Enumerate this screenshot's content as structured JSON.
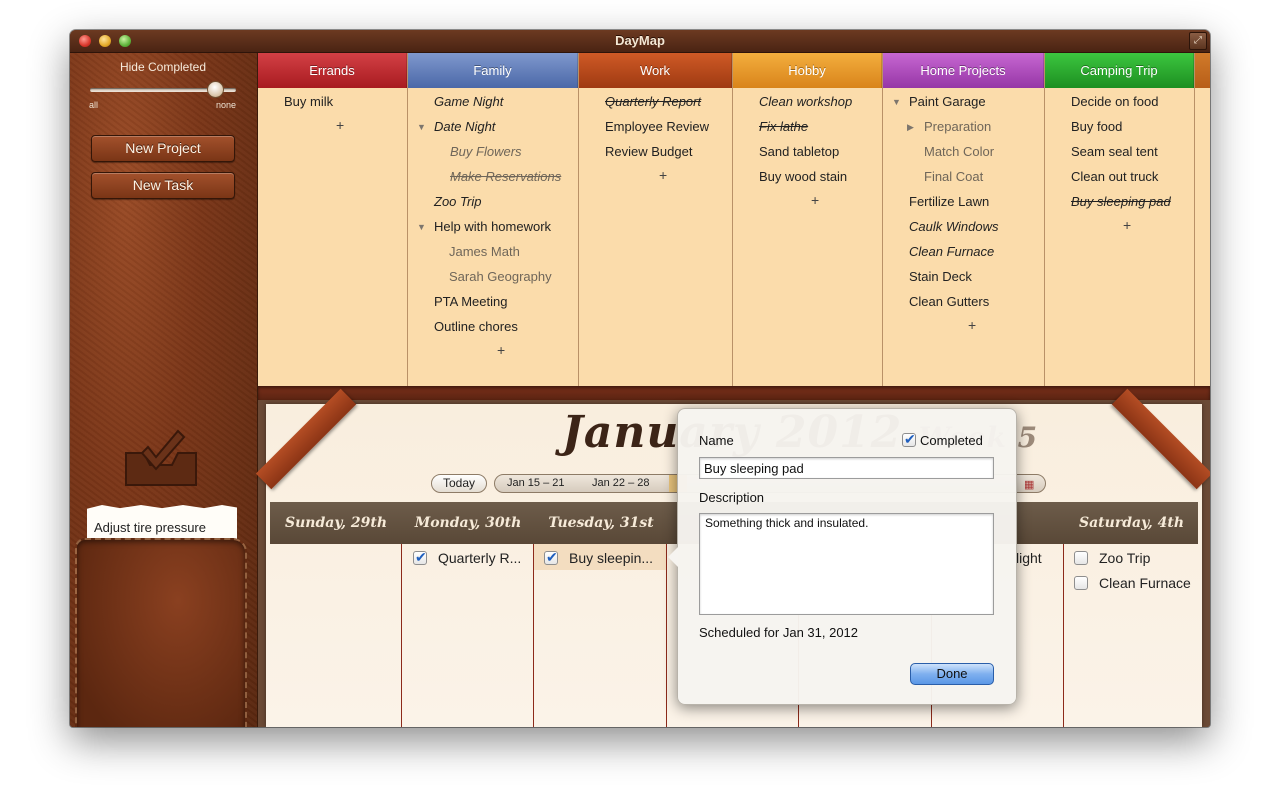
{
  "window": {
    "title": "DayMap"
  },
  "sidebar": {
    "hide_completed": "Hide Completed",
    "slider_min": "all",
    "slider_max": "none",
    "slider_value": 0.85,
    "new_project": "New Project",
    "new_task": "New Task",
    "note_text": "Adjust tire pressure"
  },
  "projects": [
    {
      "name": "Errands",
      "color": "#b8242a",
      "items": [
        {
          "text": "Buy milk"
        }
      ]
    },
    {
      "name": "Family",
      "color": "#5d78b2",
      "items": [
        {
          "text": "Game Night"
        },
        {
          "text": "Date Night"
        },
        {
          "text": "Buy Flowers"
        },
        {
          "text": "Make Reservations"
        },
        {
          "text": "Zoo Trip"
        },
        {
          "text": "Help with homework"
        },
        {
          "text": "James Math"
        },
        {
          "text": "Sarah Geography"
        },
        {
          "text": "PTA Meeting"
        },
        {
          "text": "Outline chores"
        }
      ]
    },
    {
      "name": "Work",
      "color": "#b8471d",
      "items": [
        {
          "text": "Quarterly Report"
        },
        {
          "text": "Employee Review"
        },
        {
          "text": "Review Budget"
        }
      ]
    },
    {
      "name": "Hobby",
      "color": "#e59420",
      "items": [
        {
          "text": "Clean workshop"
        },
        {
          "text": "Fix lathe"
        },
        {
          "text": "Sand tabletop"
        },
        {
          "text": "Buy wood stain"
        }
      ]
    },
    {
      "name": "Home Projects",
      "color": "#a94bb8",
      "items": [
        {
          "text": "Paint Garage"
        },
        {
          "text": "Preparation"
        },
        {
          "text": "Match Color"
        },
        {
          "text": "Final Coat"
        },
        {
          "text": "Fertilize Lawn"
        },
        {
          "text": "Caulk Windows"
        },
        {
          "text": "Clean Furnace"
        },
        {
          "text": "Stain Deck"
        },
        {
          "text": "Clean Gutters"
        }
      ]
    },
    {
      "name": "Camping Trip",
      "color": "#23a62a",
      "items": [
        {
          "text": "Decide on food"
        },
        {
          "text": "Buy food"
        },
        {
          "text": "Seam seal tent"
        },
        {
          "text": "Clean out truck"
        },
        {
          "text": "Buy sleeping pad"
        }
      ]
    }
  ],
  "add_symbol": "+",
  "calendar": {
    "month_title": "January 2012",
    "week_label": "Week 5",
    "today_btn": "Today",
    "weeks": [
      "Jan 15 – 21",
      "Jan 22 – 28"
    ],
    "days": [
      {
        "label": "Sunday, 29th"
      },
      {
        "label": "Monday, 30th"
      },
      {
        "label": "Tuesday, 31st"
      },
      {
        "label": "rd"
      },
      {
        "label": "Saturday, 4th"
      }
    ],
    "tasks": {
      "monday": [
        {
          "text": "Quarterly R...",
          "done": true
        }
      ],
      "tuesday": [
        {
          "text": "Buy sleepin...",
          "done": true
        }
      ],
      "friday": [
        {
          "text": "light"
        }
      ],
      "saturday": [
        {
          "text": "Zoo Trip",
          "done": false
        },
        {
          "text": "Clean Furnace",
          "done": false
        }
      ]
    }
  },
  "popover": {
    "name_label": "Name",
    "completed_label": "Completed",
    "completed": true,
    "name_value": "Buy sleeping pad",
    "description_label": "Description",
    "description_value": "Something thick and insulated.",
    "scheduled": "Scheduled for Jan 31, 2012",
    "done_btn": "Done"
  }
}
